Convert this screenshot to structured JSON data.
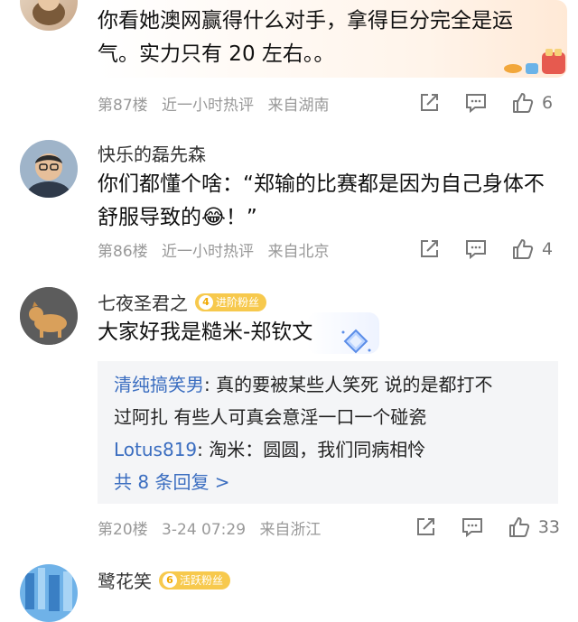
{
  "comments": [
    {
      "text_line1": "你看她澳网赢得什么对手，拿得巨分完全是运",
      "text_line2": "气。实力只有 20 左右。。",
      "floor": "第87楼",
      "time": "近一小时热评",
      "location": "来自湖南",
      "likes": "6"
    },
    {
      "username": "快乐的磊先森",
      "text_line1": "你们都懂个啥：“郑输的比赛都是因为自己身体不",
      "text_line2": "舒服导致的",
      "emoji": "😂",
      "text_line2_end": "！”",
      "floor": "第86楼",
      "time": "近一小时热评",
      "location": "来自北京",
      "likes": "4"
    },
    {
      "username": "七夜圣君之",
      "badge_level": "4",
      "badge_label": "进阶粉丝",
      "text_line1": "大家好我是糙米-郑钦文",
      "replies": [
        {
          "name": "清纯搞笑男",
          "sep": ": ",
          "text": "真的要被某些人笑死 说的是都打不",
          "text2": "过阿扎  有些人可真会意淫一口一个碰瓷"
        },
        {
          "name": "Lotus819",
          "sep": ": ",
          "text": "淘米：圆圆，我们同病相怜"
        }
      ],
      "more_replies": "共 8 条回复 >",
      "floor": "第20楼",
      "time": "3-24 07:29",
      "location": "来自浙江",
      "likes": "33"
    },
    {
      "username": "鹭花笑",
      "badge_level": "6",
      "badge_label": "活跃粉丝"
    }
  ],
  "icons": [
    "share-icon",
    "comment-icon",
    "thumbs-up-icon"
  ],
  "colors": {
    "link": "#3a6dc0",
    "meta": "#999999",
    "badge": "#f7c94d",
    "reply_bg": "#f4f5f7"
  }
}
